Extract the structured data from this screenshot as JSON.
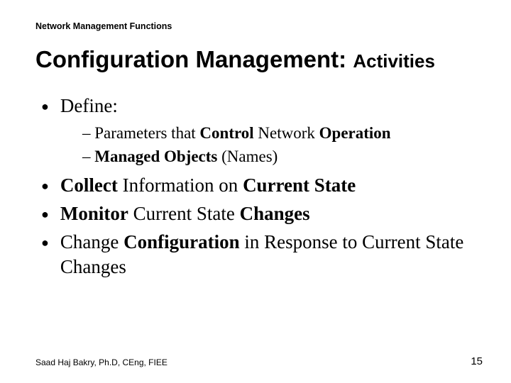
{
  "header": "Network Management Functions",
  "title_main": "Configuration  Management: ",
  "title_sub": "Activities",
  "bullets": {
    "b1": {
      "label": "Define:"
    },
    "b1sub": {
      "s1_pre": "– Parameters that ",
      "s1_b1": "Control",
      "s1_mid": " Network ",
      "s1_b2": "Operation",
      "s2_pre": "– ",
      "s2_b": "Managed Objects",
      "s2_post": " (Names)"
    },
    "b2": {
      "b1": "Collect",
      "t1": " Information on ",
      "b2": "Current State"
    },
    "b3": {
      "b1": "Monitor",
      "t1": " Current State ",
      "b2": "Changes"
    },
    "b4": {
      "t1": "Change ",
      "b1": "Configuration",
      "t2": " in Response to Current State Changes"
    }
  },
  "footer": "Saad Haj Bakry, Ph.D, CEng, FIEE",
  "page": "15"
}
